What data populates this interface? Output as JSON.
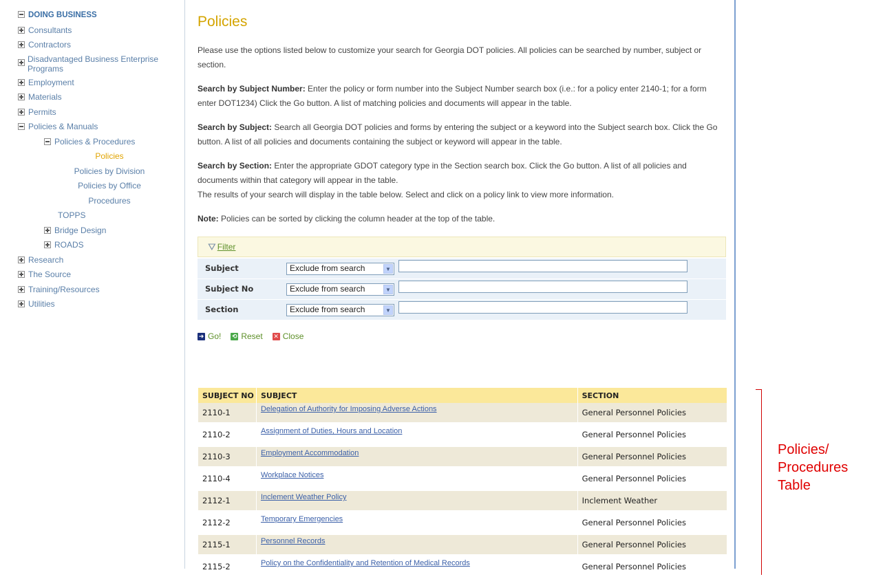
{
  "sidebar": {
    "root": "DOING BUSINESS",
    "items": [
      {
        "label": "Consultants",
        "level": 1,
        "expander": "plus"
      },
      {
        "label": "Contractors",
        "level": 1,
        "expander": "plus"
      },
      {
        "label": "Disadvantaged Business Enterprise Programs",
        "level": 1,
        "expander": "plus"
      },
      {
        "label": "Employment",
        "level": 1,
        "expander": "plus"
      },
      {
        "label": "Materials",
        "level": 1,
        "expander": "plus"
      },
      {
        "label": "Permits",
        "level": 1,
        "expander": "plus"
      },
      {
        "label": "Policies & Manuals",
        "level": 1,
        "expander": "minus"
      },
      {
        "label": "Policies & Procedures",
        "level": 2,
        "expander": "minus"
      },
      {
        "label": "Policies",
        "level": 3,
        "expander": "none",
        "active": true
      },
      {
        "label": "Policies by Division",
        "level": 3,
        "expander": "none"
      },
      {
        "label": "Policies by Office",
        "level": 3,
        "expander": "none"
      },
      {
        "label": "Procedures",
        "level": 3,
        "expander": "none"
      },
      {
        "label": "TOPPS",
        "level": 2,
        "expander": "none"
      },
      {
        "label": "Bridge Design",
        "level": 2,
        "expander": "plus"
      },
      {
        "label": "ROADS",
        "level": 2,
        "expander": "plus"
      },
      {
        "label": "Research",
        "level": 1,
        "expander": "plus"
      },
      {
        "label": "The Source",
        "level": 1,
        "expander": "plus"
      },
      {
        "label": "Training/Resources",
        "level": 1,
        "expander": "plus"
      },
      {
        "label": "Utilities",
        "level": 1,
        "expander": "plus"
      }
    ]
  },
  "main": {
    "title": "Policies",
    "intro": "Please use the options listed below to customize your search for Georgia DOT policies.   All policies can be searched by number, subject or section.",
    "sections": [
      {
        "heading": "Search by Subject Number:",
        "text": " Enter the policy or form number into the Subject Number search box (i.e.: for a policy enter 2140-1; for a form enter DOT1234)  Click the Go button.  A list of matching policies and documents will appear in the table."
      },
      {
        "heading": "Search by Subject:",
        "text": " Search all Georgia DOT policies and forms by entering the subject or a keyword into the Subject search box.  Click the Go button.   A list of all policies and documents containing the subject or keyword will appear in the table."
      },
      {
        "heading": "Search by Section:",
        "text": " Enter the appropriate GDOT category type in the Section search box. Click the Go button.  A list of all policies and documents within that category will appear in the table."
      }
    ],
    "results_note": "The results of your search will display in the table below.  Select and click on a policy link to view more information.",
    "note_heading": "Note:",
    "note_text": " Policies can be sorted by clicking the column header at the top of the table."
  },
  "filter": {
    "link_label": "Filter",
    "rows": [
      {
        "label": "Subject",
        "select_value": "Exclude from search",
        "text_value": ""
      },
      {
        "label": "Subject No",
        "select_value": "Exclude from search",
        "text_value": ""
      },
      {
        "label": "Section",
        "select_value": "Exclude from search",
        "text_value": ""
      }
    ],
    "go_label": "Go!",
    "reset_label": "Reset",
    "close_label": "Close"
  },
  "table": {
    "headers": {
      "subject_no": "SUBJECT NO",
      "subject": "SUBJECT",
      "section": "SECTION"
    },
    "rows": [
      {
        "no": "2110-1",
        "subject": "Delegation of Authority for Imposing Adverse Actions",
        "section": "General Personnel Policies"
      },
      {
        "no": "2110-2",
        "subject": "Assignment of Duties, Hours and Location",
        "section": "General Personnel Policies"
      },
      {
        "no": "2110-3",
        "subject": "Employment Accommodation",
        "section": "General Personnel Policies"
      },
      {
        "no": "2110-4",
        "subject": "Workplace Notices",
        "section": "General Personnel Policies"
      },
      {
        "no": "2112-1",
        "subject": "Inclement Weather Policy",
        "section": "Inclement Weather"
      },
      {
        "no": "2112-2",
        "subject": "Temporary Emergencies",
        "section": "General Personnel Policies"
      },
      {
        "no": "2115-1",
        "subject": "Personnel Records",
        "section": "General Personnel Policies"
      },
      {
        "no": "2115-2",
        "subject": "Policy on the Confidentiality and Retention of Medical Records",
        "section": "General Personnel Policies"
      }
    ]
  },
  "annotation": {
    "line1": "Policies/",
    "line2": "Procedures",
    "line3": "Table",
    "color": "#e00000"
  }
}
